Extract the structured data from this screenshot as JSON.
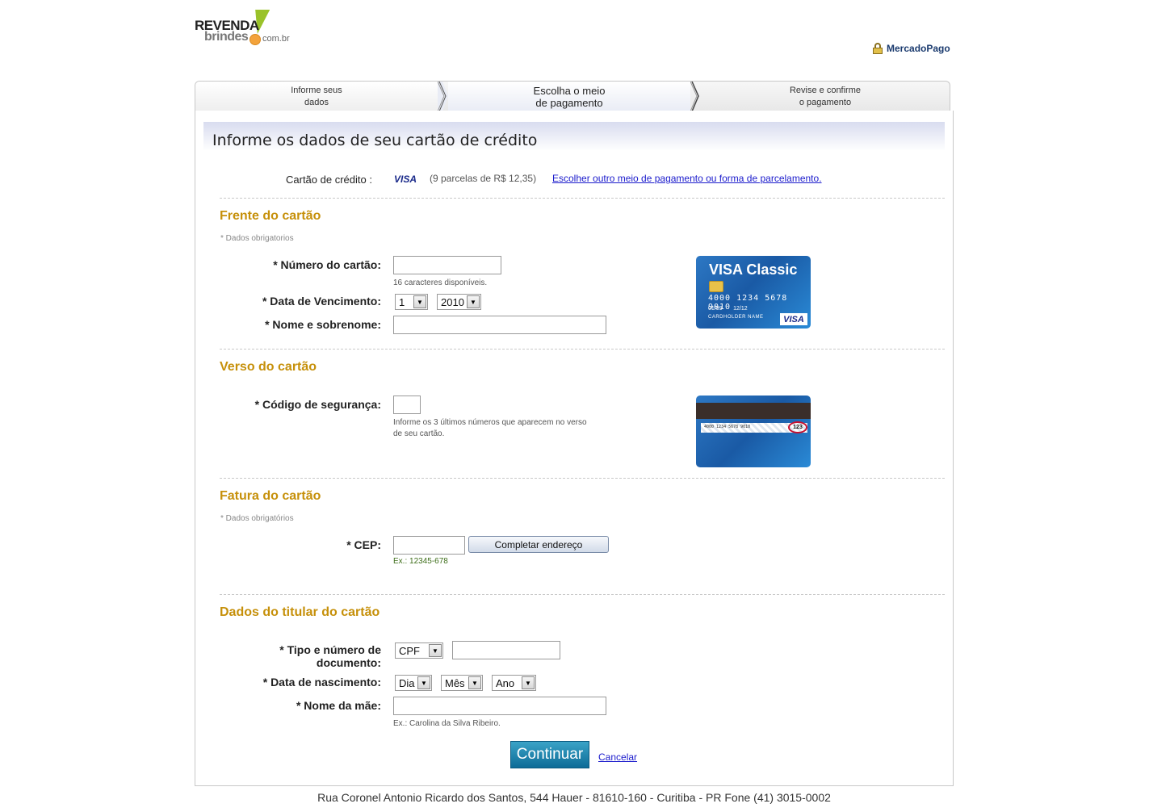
{
  "brand": {
    "logo_line1": "REVENDA",
    "logo_line2": "brindes",
    "logo_domain": "com.br",
    "payment_provider": "MercadoPago"
  },
  "steps": [
    {
      "line1": "Informe seus",
      "line2": "dados"
    },
    {
      "line1": "Escolha o meio",
      "line2": "de pagamento"
    },
    {
      "line1": "Revise e confirme",
      "line2": "o pagamento"
    }
  ],
  "heading": "Informe os dados de seu cartão de crédito",
  "card_choice": {
    "label": "Cartão de crédito :",
    "brand": "VISA",
    "installments": "(9 parcelas de R$ 12,35)",
    "change_link": "Escolher outro meio de pagamento ou forma de parcelamento."
  },
  "front": {
    "title": "Frente do cartão",
    "required_note": "* Dados obrigatorios",
    "card_number_label": "* Número do cartão:",
    "card_number_value": "",
    "card_number_hint": "16 caracteres disponíveis.",
    "expiry_label": "* Data de Vencimento:",
    "expiry_month": "1",
    "expiry_year": "2010",
    "name_label": "* Nome e sobrenome:",
    "name_value": "",
    "card_image": {
      "title": "VISA Classic",
      "number": "4000 1234 5678 9010",
      "valid_from": "01/99",
      "valid_thru": "12/12",
      "holder": "CARDHOLDER NAME",
      "brand": "VISA"
    }
  },
  "back": {
    "title": "Verso do cartão",
    "cvv_label": "* Código de segurança:",
    "cvv_value": "",
    "cvv_hint_1": "Informe os 3 últimos números que aparecem no verso",
    "cvv_hint_2": "de seu cartão.",
    "card_image": {
      "signature_number": "4000 1234 5678 9010",
      "cvv": "123"
    }
  },
  "billing": {
    "title": "Fatura do cartão",
    "required_note": "* Dados obrigatórios",
    "cep_label": "* CEP:",
    "cep_value": "",
    "cep_hint": "Ex.: 12345-678",
    "complete_button": "Completar endereço"
  },
  "holder": {
    "title": "Dados do titular do cartão",
    "doc_label_1": "* Tipo e número de",
    "doc_label_2": "documento:",
    "doc_type": "CPF",
    "doc_number": "",
    "birth_label": "* Data de nascimento:",
    "birth_day": "Dia",
    "birth_month": "Mês",
    "birth_year": "Ano",
    "mother_label": "* Nome da mãe:",
    "mother_value": "",
    "mother_hint": "Ex.: Carolina da Silva Ribeiro."
  },
  "actions": {
    "continue": "Continuar",
    "cancel": "Cancelar"
  },
  "footer": "Rua Coronel Antonio Ricardo dos Santos, 544 Hauer - 81610-160 - Curitiba - PR Fone (41) 3015-0002",
  "colors": {
    "section_title": "#c6900a",
    "link": "#1a1acc",
    "primary_button": "#0d6b97"
  }
}
